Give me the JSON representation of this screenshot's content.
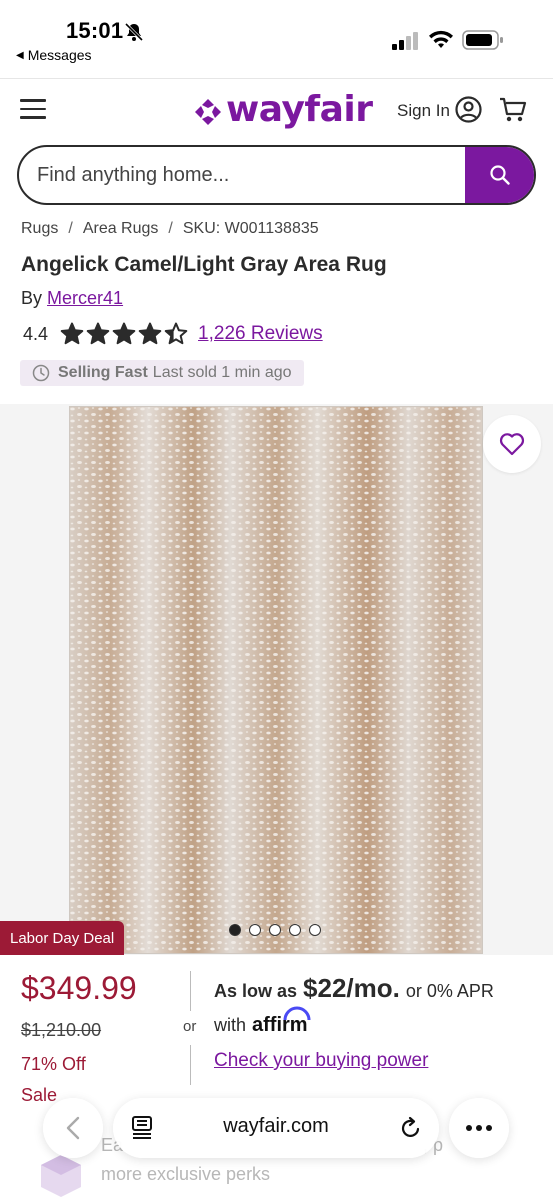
{
  "status_bar": {
    "time": "15:01",
    "back_app": "Messages"
  },
  "header": {
    "logo_text": "wayfair",
    "sign_in": "Sign In"
  },
  "search": {
    "placeholder": "Find anything home..."
  },
  "breadcrumb": {
    "items": [
      "Rugs",
      "Area Rugs",
      "SKU: W001138835"
    ],
    "separator": "/"
  },
  "product": {
    "title": "Angelick Camel/Light Gray Area Rug",
    "by_prefix": "By",
    "brand": "Mercer41",
    "rating": "4.4",
    "rating_value": 4.4,
    "rating_max": 5,
    "reviews": "1,226 Reviews",
    "selling_label": "Selling Fast",
    "selling_detail": "Last sold 1 min ago"
  },
  "gallery": {
    "image_count": 5,
    "active_index": 0,
    "deal_badge": "Labor Day Deal"
  },
  "pricing": {
    "price": "$349.99",
    "was_price": "$1,210.00",
    "off": "71% Off",
    "sale": "Sale",
    "or": "or",
    "as_low_as": "As low as",
    "monthly": "$22/mo.",
    "apr": "or 0% APR",
    "with": "with",
    "affirm": "affirm",
    "buying_power": "Check your buying power"
  },
  "perks": {
    "line1": "Ea",
    "line1_end": ", p",
    "line2": "more exclusive perks"
  },
  "browser": {
    "url": "wayfair.com"
  },
  "colors": {
    "brand_purple": "#7b189f",
    "sale_red": "#9c1a36",
    "badge_bg": "#f0eaf3"
  }
}
